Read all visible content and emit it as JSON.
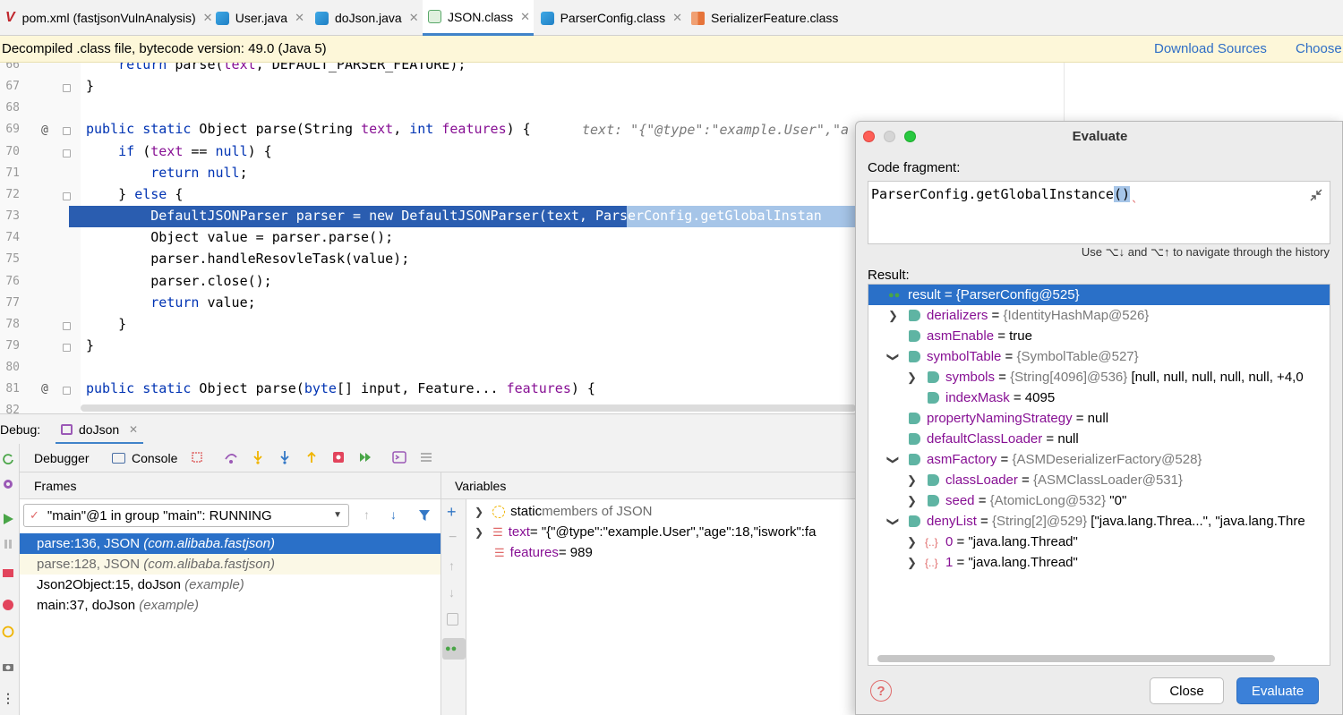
{
  "tabs": [
    {
      "label": "pom.xml (fastjsonVulnAnalysis)",
      "icon": "maven-icon"
    },
    {
      "label": "User.java",
      "icon": "java-class-icon"
    },
    {
      "label": "doJson.java",
      "icon": "java-class-icon"
    },
    {
      "label": "JSON.class",
      "icon": "compiled-class-icon"
    },
    {
      "label": "ParserConfig.class",
      "icon": "java-class-icon"
    },
    {
      "label": "SerializerFeature.class",
      "icon": "enum-icon"
    }
  ],
  "tab_close": "✕",
  "banner": {
    "text": "Decompiled .class file, bytecode version: 49.0 (Java 5)",
    "download": "Download Sources",
    "choose": "Choose"
  },
  "code_lines": [
    {
      "n": "66",
      "text": "    return parse(text, DEFAULT_PARSER_FEATURE);"
    },
    {
      "n": "67",
      "text": "}"
    },
    {
      "n": "68",
      "text": ""
    },
    {
      "n": "69",
      "text": "public static Object parse(String text, int features) {"
    },
    {
      "n": "70",
      "text": "    if (text == null) {"
    },
    {
      "n": "71",
      "text": "        return null;"
    },
    {
      "n": "72",
      "text": "    } else {"
    },
    {
      "n": "73",
      "text": "        DefaultJSONParser parser = new DefaultJSONParser(text, ParserConfig.getGlobalInstan"
    },
    {
      "n": "74",
      "text": "        Object value = parser.parse();"
    },
    {
      "n": "75",
      "text": "        parser.handleResovleTask(value);"
    },
    {
      "n": "76",
      "text": "        parser.close();"
    },
    {
      "n": "77",
      "text": "        return value;"
    },
    {
      "n": "78",
      "text": "    }"
    },
    {
      "n": "79",
      "text": "}"
    },
    {
      "n": "80",
      "text": ""
    },
    {
      "n": "81",
      "text": "public static Object parse(byte[] input, Feature... features) {"
    },
    {
      "n": "82",
      "text": ""
    }
  ],
  "inline_hint": "text: \"{\"@type\":\"example.User\",\"a",
  "debug": {
    "label": "Debug:",
    "session": "doJson",
    "tab_debugger": "Debugger",
    "tab_console": "Console",
    "frames_header": "Frames",
    "variables_header": "Variables",
    "thread": "\"main\"@1 in group \"main\": RUNNING",
    "frames": [
      {
        "loc": "parse:136, JSON",
        "pkg": "(com.alibaba.fastjson)"
      },
      {
        "loc": "parse:128, JSON",
        "pkg": "(com.alibaba.fastjson)"
      },
      {
        "loc": "Json2Object:15, doJson",
        "pkg": "(example)"
      },
      {
        "loc": "main:37, doJson",
        "pkg": "(example)"
      }
    ],
    "variables": [
      {
        "name": "static",
        "rest": " members of JSON"
      },
      {
        "name": "text",
        "rest": " = \"{\"@type\":\"example.User\",\"age\":18,\"iswork\":fa"
      },
      {
        "name": "features",
        "rest": " = 989"
      }
    ]
  },
  "evaluate": {
    "title": "Evaluate",
    "code_label": "Code fragment:",
    "code_prefix": "ParserConfig.getGlobalInstance",
    "code_paren": "()",
    "history_hint": "Use ⌥↓ and ⌥↑ to navigate through the history",
    "result_label": "Result:",
    "results": [
      {
        "name": "result",
        "val": " = {ParserConfig@525}",
        "extra": ""
      },
      {
        "name": "derializers",
        "val": " = ",
        "dim": "{IdentityHashMap@526}",
        "extra": ""
      },
      {
        "name": "asmEnable",
        "val": " = true",
        "dim": "",
        "extra": ""
      },
      {
        "name": "symbolTable",
        "val": " = ",
        "dim": "{SymbolTable@527}",
        "extra": ""
      },
      {
        "name": "symbols",
        "val": " = ",
        "dim": "{String[4096]@536}",
        "extra": " [null, null, null, null, null, +4,0"
      },
      {
        "name": "indexMask",
        "val": " = 4095",
        "dim": "",
        "extra": ""
      },
      {
        "name": "propertyNamingStrategy",
        "val": " = null",
        "dim": "",
        "extra": ""
      },
      {
        "name": "defaultClassLoader",
        "val": " = null",
        "dim": "",
        "extra": ""
      },
      {
        "name": "asmFactory",
        "val": " = ",
        "dim": "{ASMDeserializerFactory@528}",
        "extra": ""
      },
      {
        "name": "classLoader",
        "val": " = ",
        "dim": "{ASMClassLoader@531}",
        "extra": ""
      },
      {
        "name": "seed",
        "val": " = ",
        "dim": "{AtomicLong@532}",
        "extra": " \"0\""
      },
      {
        "name": "denyList",
        "val": " = ",
        "dim": "{String[2]@529}",
        "extra": " [\"java.lang.Threa...\", \"java.lang.Thre"
      },
      {
        "name": "0",
        "val": " = \"java.lang.Thread\"",
        "dim": "",
        "extra": ""
      },
      {
        "name": "1",
        "val": " = \"java.lang.Thread\"",
        "dim": "",
        "extra": ""
      }
    ],
    "help": "?",
    "close": "Close",
    "evaluate_btn": "Evaluate"
  }
}
